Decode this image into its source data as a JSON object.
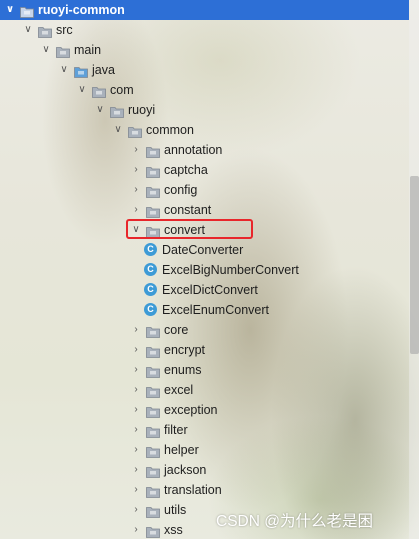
{
  "tree": [
    {
      "label": "ruoyi-common",
      "kind": "module",
      "expanded": true,
      "indent": 0
    },
    {
      "label": "src",
      "kind": "folder",
      "expanded": true,
      "indent": 1
    },
    {
      "label": "main",
      "kind": "folder",
      "expanded": true,
      "indent": 2
    },
    {
      "label": "java",
      "kind": "source-folder",
      "expanded": true,
      "indent": 3
    },
    {
      "label": "com",
      "kind": "package",
      "expanded": true,
      "indent": 4
    },
    {
      "label": "ruoyi",
      "kind": "package",
      "expanded": true,
      "indent": 5
    },
    {
      "label": "common",
      "kind": "package",
      "expanded": true,
      "indent": 6
    },
    {
      "label": "annotation",
      "kind": "package",
      "expanded": false,
      "indent": 7
    },
    {
      "label": "captcha",
      "kind": "package",
      "expanded": false,
      "indent": 7
    },
    {
      "label": "config",
      "kind": "package",
      "expanded": false,
      "indent": 7
    },
    {
      "label": "constant",
      "kind": "package",
      "expanded": false,
      "indent": 7
    },
    {
      "label": "convert",
      "kind": "package",
      "expanded": true,
      "indent": 7,
      "highlighted": true
    },
    {
      "label": "DateConverter",
      "kind": "class",
      "indent": 8
    },
    {
      "label": "ExcelBigNumberConvert",
      "kind": "class",
      "indent": 8
    },
    {
      "label": "ExcelDictConvert",
      "kind": "class",
      "indent": 8
    },
    {
      "label": "ExcelEnumConvert",
      "kind": "class",
      "indent": 8
    },
    {
      "label": "core",
      "kind": "package",
      "expanded": false,
      "indent": 7
    },
    {
      "label": "encrypt",
      "kind": "package",
      "expanded": false,
      "indent": 7
    },
    {
      "label": "enums",
      "kind": "package",
      "expanded": false,
      "indent": 7
    },
    {
      "label": "excel",
      "kind": "package",
      "expanded": false,
      "indent": 7
    },
    {
      "label": "exception",
      "kind": "package",
      "expanded": false,
      "indent": 7
    },
    {
      "label": "filter",
      "kind": "package",
      "expanded": false,
      "indent": 7
    },
    {
      "label": "helper",
      "kind": "package",
      "expanded": false,
      "indent": 7
    },
    {
      "label": "jackson",
      "kind": "package",
      "expanded": false,
      "indent": 7
    },
    {
      "label": "translation",
      "kind": "package",
      "expanded": false,
      "indent": 7
    },
    {
      "label": "utils",
      "kind": "package",
      "expanded": false,
      "indent": 7
    },
    {
      "label": "xss",
      "kind": "package",
      "expanded": false,
      "indent": 7
    }
  ],
  "class_icon_letter": "C",
  "watermark": "CSDN @为什么老是困",
  "colors": {
    "selection": "#2d6fd6",
    "highlight_box": "#e8262b",
    "folder": "#a9b1bb",
    "source_folder": "#5fa0d8",
    "class_icon": "#3d9bd6"
  }
}
